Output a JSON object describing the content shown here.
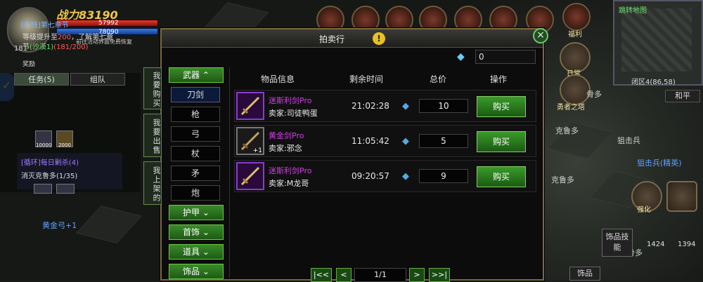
{
  "hud": {
    "power": "战力83190",
    "hp": "57992",
    "mp": "78090",
    "level": "181",
    "hint": "前往活动界面免费恢复"
  },
  "quest": {
    "tab_task": "任务(5)",
    "tab_team": "组队",
    "main_title": "[主线]第七章节",
    "line1_a": "等级提升至",
    "line1_level": "200",
    "line1_b": "，了解第七章",
    "line2_a": "节",
    "line2_loc": "(沙漠1)",
    "line2_prog": "(181/200)",
    "reward": "奖励",
    "reward_qty": [
      "10000",
      "2000"
    ],
    "daily_title": "[循环]每日剿杀(4)",
    "daily_desc": "消灭克鲁多(1/35)"
  },
  "floating_label": "黄金弓+1",
  "auction": {
    "title": "拍卖行",
    "close": "×",
    "balance": "0",
    "side_tabs": [
      "我要购买",
      "我要出售",
      "我上架的"
    ],
    "categories": {
      "weapon": "武器",
      "weapon_subs": [
        "刀剑",
        "枪",
        "弓",
        "杖",
        "矛",
        "炮"
      ],
      "armor": "护甲",
      "jewelry": "首饰",
      "props": "道具",
      "accessory": "饰品"
    },
    "headers": {
      "info": "物品信息",
      "time": "剩余时间",
      "price": "总价",
      "action": "操作"
    },
    "rows": [
      {
        "name": "迷斯利剑Pro",
        "seller": "卖家:司徒鸭蛋",
        "time": "21:02:28",
        "price": "10",
        "buy": "购买",
        "plus": ""
      },
      {
        "name": "黄金剑Pro",
        "seller": "卖家:邪念",
        "time": "11:05:42",
        "price": "5",
        "buy": "购买",
        "plus": "+1"
      },
      {
        "name": "迷斯利剑Pro",
        "seller": "卖家:M龙哥",
        "time": "09:20:57",
        "price": "9",
        "buy": "购买",
        "plus": ""
      }
    ],
    "pager": {
      "first": "|<<",
      "prev": "<",
      "page": "1/1",
      "next": ">",
      "last": ">>|"
    }
  },
  "right": {
    "topline": "跳转地图",
    "map_coord": "闭区4(86,58)",
    "peace": "和平",
    "label_welfare": "福利",
    "label_daily": "日常",
    "label_boss": "勇者之塔",
    "labels_world": [
      "骨多",
      "克鲁多",
      "狙击兵",
      "狙击兵(精英)",
      "克鲁多",
      "骨多"
    ],
    "label_forge": "强化",
    "skill_box": "饰品技能",
    "skill_box2": "饰品",
    "inv_counts": [
      "1424",
      "1394"
    ]
  }
}
